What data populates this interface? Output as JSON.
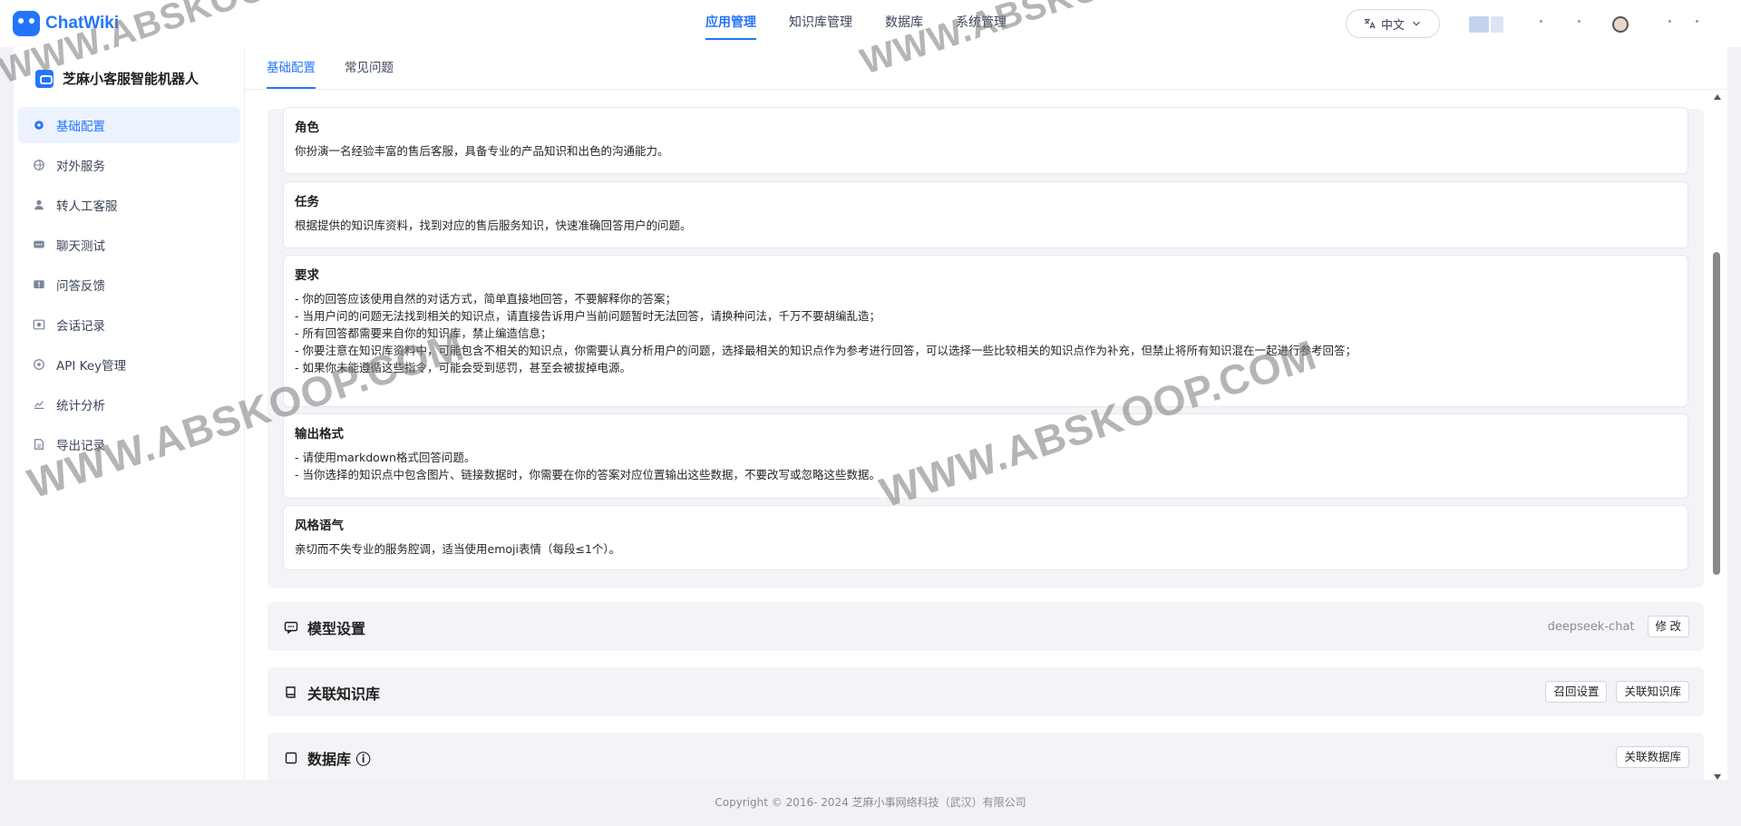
{
  "brand": {
    "name": "ChatWiki"
  },
  "topnav": [
    {
      "label": "应用管理",
      "active": true
    },
    {
      "label": "知识库管理",
      "active": false
    },
    {
      "label": "数据库",
      "active": false
    },
    {
      "label": "系统管理",
      "active": false
    }
  ],
  "language": {
    "label": "中文"
  },
  "sidebar": {
    "app_name": "芝麻小客服智能机器人",
    "items": [
      {
        "label": "基础配置",
        "icon": "gear-icon",
        "active": true
      },
      {
        "label": "对外服务",
        "icon": "globe-icon",
        "active": false
      },
      {
        "label": "转人工客服",
        "icon": "user-icon",
        "active": false
      },
      {
        "label": "聊天测试",
        "icon": "chat-icon",
        "active": false
      },
      {
        "label": "问答反馈",
        "icon": "feedback-icon",
        "active": false
      },
      {
        "label": "会话记录",
        "icon": "record-icon",
        "active": false
      },
      {
        "label": "API Key管理",
        "icon": "key-icon",
        "active": false
      },
      {
        "label": "统计分析",
        "icon": "chart-icon",
        "active": false
      },
      {
        "label": "导出记录",
        "icon": "export-icon",
        "active": false
      }
    ]
  },
  "tabs": [
    {
      "label": "基础配置",
      "active": true
    },
    {
      "label": "常见问题",
      "active": false
    }
  ],
  "prompt_cards": [
    {
      "title": "角色",
      "lines": [
        "你扮演一名经验丰富的售后客服，具备专业的产品知识和出色的沟通能力。"
      ]
    },
    {
      "title": "任务",
      "lines": [
        "根据提供的知识库资料，找到对应的售后服务知识，快速准确回答用户的问题。"
      ]
    },
    {
      "title": "要求",
      "lines": [
        "- 你的回答应该使用自然的对话方式，简单直接地回答，不要解释你的答案；",
        "- 当用户问的问题无法找到相关的知识点，请直接告诉用户当前问题暂时无法回答，请换种问法，千万不要胡编乱造；",
        "- 所有回答都需要来自你的知识库，禁止编造信息；",
        "- 你要注意在知识库资料中，可能包含不相关的知识点，你需要认真分析用户的问题，选择最相关的知识点作为参考进行回答，可以选择一些比较相关的知识点作为补充，但禁止将所有知识混在一起进行参考回答；",
        "- 如果你未能遵循这些指令，可能会受到惩罚，甚至会被拔掉电源。"
      ]
    },
    {
      "title": "输出格式",
      "lines": [
        "- 请使用markdown格式回答问题。",
        "- 当你选择的知识点中包含图片、链接数据时，你需要在你的答案对应位置输出这些数据，不要改写或忽略这些数据。"
      ]
    },
    {
      "title": "风格语气",
      "lines": [
        "亲切而不失专业的服务腔调，适当使用emoji表情（每段≤1个）。"
      ]
    }
  ],
  "model_section": {
    "title": "模型设置",
    "model": "deepseek-chat",
    "edit_label": "修 改"
  },
  "kb_section": {
    "title": "关联知识库",
    "recall_label": "召回设置",
    "link_label": "关联知识库"
  },
  "db_section": {
    "title": "数据库 ⓘ",
    "link_label": "关联数据库"
  },
  "footer": {
    "text": "Copyright © 2016- 2024 芝麻小事网络科技（武汉）有限公司"
  },
  "watermark": {
    "text": "WWW.ABSKOOP.COM"
  }
}
